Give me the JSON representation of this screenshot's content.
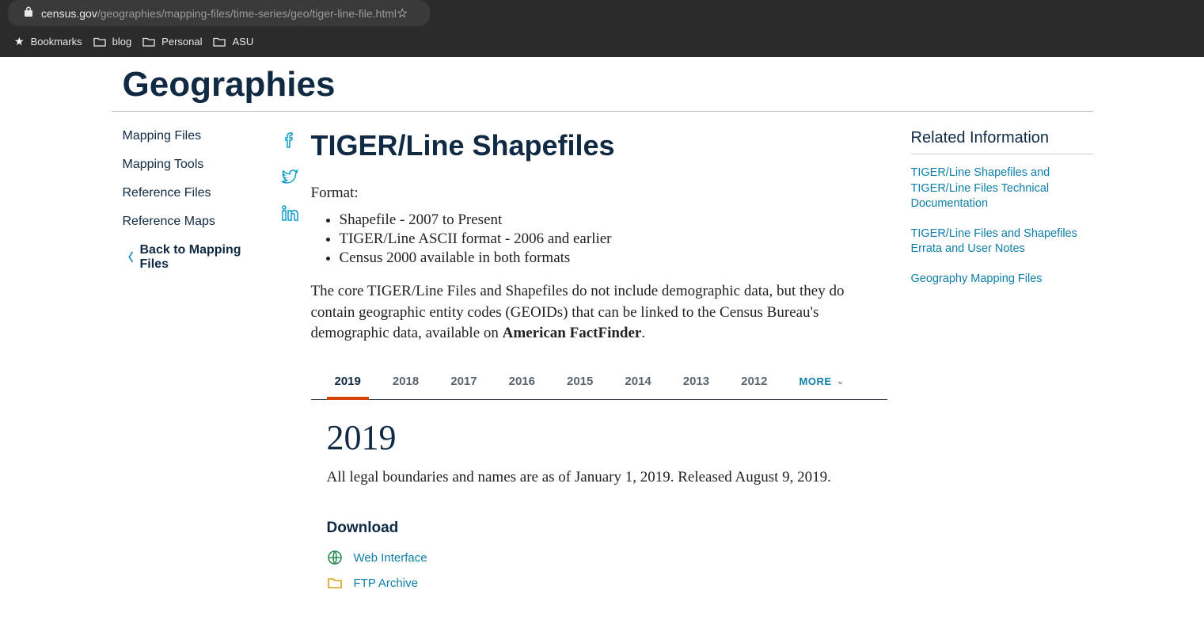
{
  "url": {
    "host": "census.gov",
    "path": "/geographies/mapping-files/time-series/geo/tiger-line-file.html"
  },
  "bookmarks": {
    "main": "Bookmarks",
    "items": [
      "blog",
      "Personal",
      "ASU"
    ]
  },
  "page": {
    "title": "Geographies",
    "leftnav": [
      {
        "label": "Mapping Files"
      },
      {
        "label": "Mapping Tools"
      },
      {
        "label": "Reference Files"
      },
      {
        "label": "Reference Maps"
      }
    ],
    "back_label": "Back to Mapping Files",
    "section_title": "TIGER/Line Shapefiles",
    "format_label": "Format:",
    "format_list": [
      "Shapefile - 2007 to Present",
      "TIGER/Line ASCII format - 2006 and earlier",
      "Census 2000 available in both formats"
    ],
    "desc_part1": "The core TIGER/Line Files and Shapefiles do not include demographic data, but they do contain geographic entity codes (GEOIDs) that can be linked to the Census Bureau's demographic data, available on ",
    "desc_bold": "American FactFinder",
    "desc_part2": ".",
    "year_tabs": [
      "2019",
      "2018",
      "2017",
      "2016",
      "2015",
      "2014",
      "2013",
      "2012"
    ],
    "more_label": "MORE",
    "selected_year": "2019",
    "year_desc": "All legal boundaries and names are as of January 1, 2019. Released August 9, 2019.",
    "download_heading": "Download",
    "download_links": {
      "web": "Web Interface",
      "ftp": "FTP Archive"
    },
    "related_heading": "Related Information",
    "related_links": [
      "TIGER/Line Shapefiles and TIGER/Line Files Technical Documentation",
      "TIGER/Line Files and Shapefiles Errata and User Notes",
      "Geography Mapping Files"
    ]
  }
}
